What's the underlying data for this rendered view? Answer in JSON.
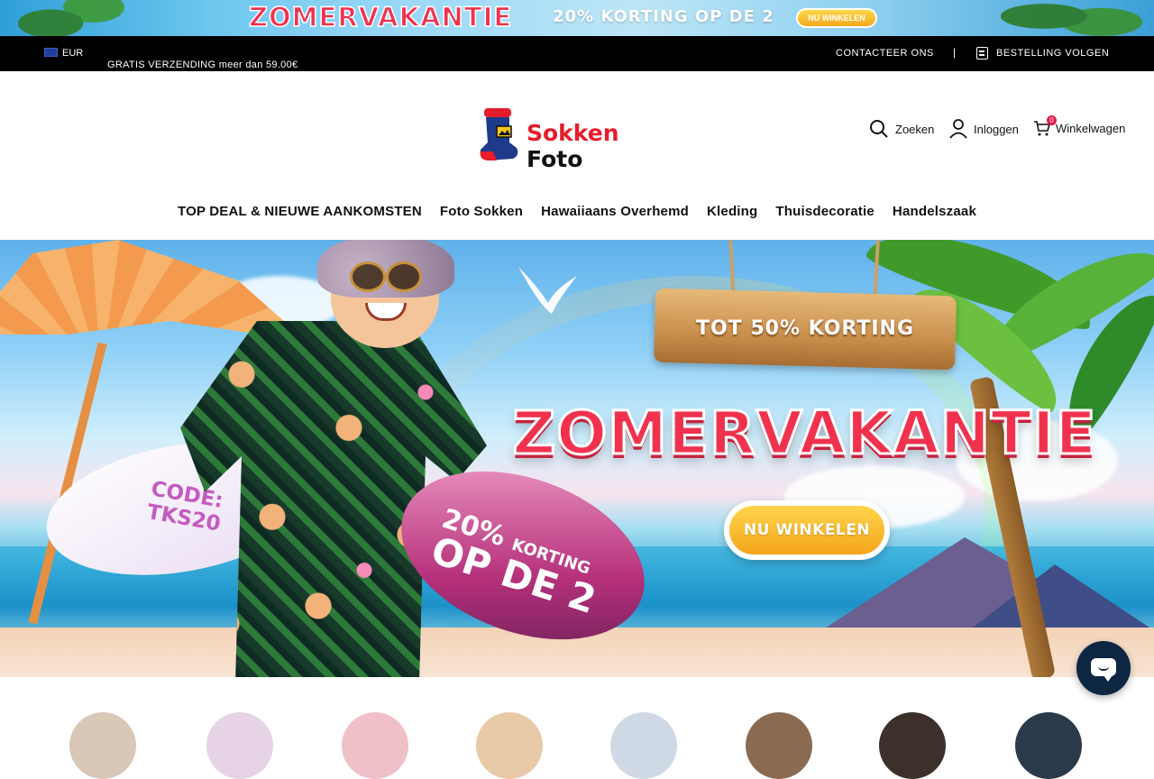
{
  "promo_banner": {
    "title": "ZOMERVAKANTIE",
    "subtitle": "20% KORTING OP DE 2",
    "button_label": "NU WINKELEN"
  },
  "topbar": {
    "currency": "EUR",
    "free_shipping": "GRATIS VERZENDING meer dan 59.00€",
    "contact": "CONTACTEER ONS",
    "separator": "|",
    "track_order": "BESTELLING VOLGEN"
  },
  "header": {
    "logo_part1": "Sokken",
    "logo_part2": "Foto",
    "search_label": "Zoeken",
    "login_label": "Inloggen",
    "cart_label": "Winkelwagen",
    "cart_count": "0"
  },
  "nav": {
    "items": [
      "TOP DEAL & NIEUWE AANKOMSTEN",
      "Foto Sokken",
      "Hawaiiaans Overhemd",
      "Kleding",
      "Thuisdecoratie",
      "Handelszaak"
    ]
  },
  "hero": {
    "sign_text": "TOT 50% KORTING",
    "title": "ZOMERVAKANTIE",
    "button_label": "NU WINKELEN",
    "code_line1": "CODE:",
    "code_line2": "TKS20",
    "board_line1_pct": "20%",
    "board_line1_word": "KORTING",
    "board_line2": "OP DE 2"
  },
  "colors": {
    "brand_red": "#e51d2b",
    "title_red": "#f0324e",
    "button_yellow": "#f5a51a",
    "topbar_bg": "#000000",
    "chat_bg": "#0d2743"
  },
  "category_circles": {
    "colors": [
      "#d9c7b8",
      "#e7d3e6",
      "#f0c0c8",
      "#e8c9a8",
      "#cfd9e6",
      "#8a6b52",
      "#3d2f2a",
      "#2a3a4a"
    ]
  }
}
